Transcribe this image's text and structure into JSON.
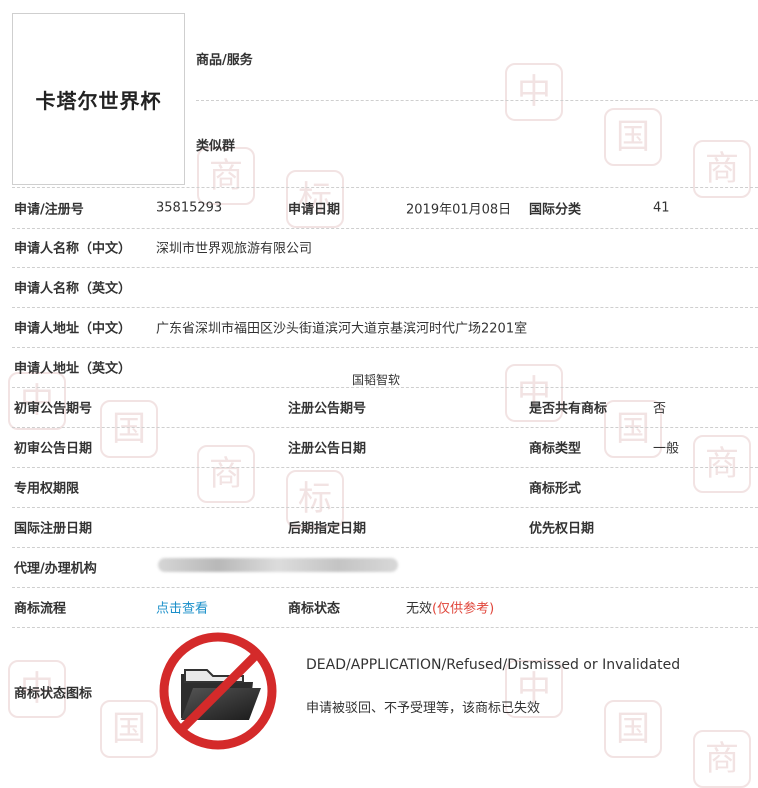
{
  "trademark": {
    "name": "卡塔尔世界杯"
  },
  "header": {
    "goods_label": "商品/服务",
    "similar_group_label": "类似群"
  },
  "fields": {
    "reg_no_label": "申请/注册号",
    "reg_no": "35815293",
    "app_date_label": "申请日期",
    "app_date": "2019年01月08日",
    "intl_class_label": "国际分类",
    "intl_class": "41",
    "applicant_cn_label": "申请人名称（中文）",
    "applicant_cn": "深圳市世界观旅游有限公司",
    "applicant_en_label": "申请人名称（英文）",
    "address_cn_label": "申请人地址（中文）",
    "address_cn": "广东省深圳市福田区沙头街道滨河大道京基滨河时代广场2201室",
    "address_en_label": "申请人地址（英文）",
    "prelim_pub_no_label": "初审公告期号",
    "reg_pub_no_label": "注册公告期号",
    "shared_label": "是否共有商标",
    "shared": "否",
    "prelim_pub_date_label": "初审公告日期",
    "reg_pub_date_label": "注册公告日期",
    "tm_type_label": "商标类型",
    "tm_type": "一般",
    "exclusive_period_label": "专用权期限",
    "tm_form_label": "商标形式",
    "intl_reg_date_label": "国际注册日期",
    "later_designation_label": "后期指定日期",
    "priority_date_label": "优先权日期",
    "agent_label": "代理/办理机构",
    "process_label": "商标流程",
    "process_link": "点击查看",
    "status_label": "商标状态",
    "status": "无效",
    "status_note": "(仅供参考)",
    "status_icon_label": "商标状态图标"
  },
  "watermark_center": "国韬智软",
  "status_detail": {
    "en": "DEAD/APPLICATION/Refused/Dismissed or Invalidated",
    "cn": "申请被驳回、不予受理等，该商标已失效",
    "icon": "prohibited-folder-icon"
  },
  "watermark": {
    "chars": [
      "中",
      "国",
      "商",
      "标"
    ],
    "color": "#f2e3e3"
  },
  "colors": {
    "link": "#1a8fc9",
    "note": "#e0453a",
    "prohibit": "#d42a2a"
  }
}
